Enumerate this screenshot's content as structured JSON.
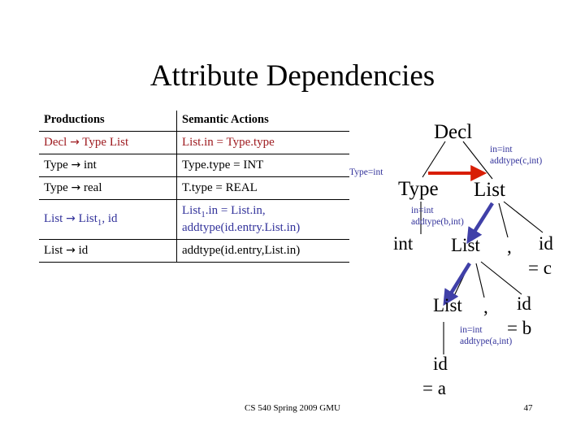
{
  "slide": {
    "title": "Attribute Dependencies",
    "footer": "CS 540 Spring 2009 GMU",
    "page_number": "47"
  },
  "colors": {
    "red_row": "#9e1b20",
    "blue_row": "#33339b",
    "red_arrow": "#d81e05",
    "blue_arrow": "#4040a8",
    "text": "#000000"
  },
  "table": {
    "headers": {
      "productions": "Productions",
      "semantic_actions": "Semantic Actions"
    },
    "rows": [
      {
        "production_lhs": "Decl",
        "production_arrow": "→",
        "production_rhs": "Type List",
        "semantic": "List.in = Type.type",
        "semantic2": "",
        "color": "red"
      },
      {
        "production_lhs": "Type",
        "production_arrow": "→",
        "production_rhs": "int",
        "semantic": "Type.type = INT",
        "semantic2": "",
        "color": "black"
      },
      {
        "production_lhs": "Type",
        "production_arrow": "→",
        "production_rhs": "real",
        "semantic": "T.type = REAL",
        "semantic2": "",
        "color": "black"
      },
      {
        "production_lhs": "List",
        "production_arrow": "→",
        "production_rhs": "List",
        "production_sub": "1",
        "production_tail": ", id",
        "semantic_pre": "List",
        "semantic_sub": "1",
        "semantic": ".in = List.in,",
        "semantic2": "addtype(id.entry.List.in)",
        "color": "blue"
      },
      {
        "production_lhs": "List",
        "production_arrow": "→",
        "production_rhs": "id",
        "semantic": "addtype(id.entry,List.in)",
        "semantic2": "",
        "color": "black"
      }
    ]
  },
  "tree": {
    "nodes": [
      {
        "id": "decl",
        "label": "Decl"
      },
      {
        "id": "type",
        "label": "Type"
      },
      {
        "id": "list1",
        "label": "List"
      },
      {
        "id": "int",
        "label": "int"
      },
      {
        "id": "list2",
        "label": "List"
      },
      {
        "id": "comma1",
        "label": ","
      },
      {
        "id": "idc",
        "label": "id"
      },
      {
        "id": "eqc",
        "label": "= c"
      },
      {
        "id": "list3",
        "label": "List"
      },
      {
        "id": "comma2",
        "label": ","
      },
      {
        "id": "idb",
        "label": "id"
      },
      {
        "id": "eqb",
        "label": "= b"
      },
      {
        "id": "ida",
        "label": "id"
      },
      {
        "id": "eqa",
        "label": "= a"
      }
    ],
    "annotations": [
      {
        "id": "ann-type",
        "line1": "Type=int",
        "line2": ""
      },
      {
        "id": "ann-listc",
        "line1": "in=int",
        "line2": "addtype(c,int)"
      },
      {
        "id": "ann-listb",
        "line1": "in=int",
        "line2": "addtype(b,int)"
      },
      {
        "id": "ann-lista",
        "line1": "in=int",
        "line2": "addtype(a,int)"
      }
    ]
  }
}
